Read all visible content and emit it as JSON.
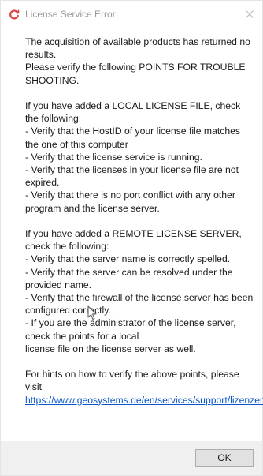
{
  "dialog": {
    "title": "License Service Error",
    "icon": "refresh-arrow-icon",
    "accent_color": "#d9473f",
    "close_icon": "close-icon"
  },
  "message": {
    "intro_1": "The acquisition of available products has returned no results.",
    "intro_2": "Please verify the following POINTS FOR TROUBLE SHOOTING.",
    "local_heading": "If you have added a LOCAL LICENSE FILE, check the following:",
    "local_items": [
      "- Verify that the HostID of your license file matches the one of this computer",
      "- Verify that the license service is running.",
      "- Verify that the licenses in your license file are not expired.",
      "- Verify that there is no port conflict with any other program and the license server."
    ],
    "remote_heading": "If you have added a REMOTE LICENSE SERVER, check the following:",
    "remote_items": [
      "- Verify that the server name is correctly spelled.",
      "- Verify that the server can be resolved under the provided name.",
      "- Verify that the firewall of the license server has been configured correctly.",
      "- If you are the administrator of the license server, check the points for a local",
      "license file on the license server as well."
    ],
    "hint_text": "For hints on how to verify the above points, please visit",
    "hint_link": "https://www.geosystems.de/en/services/support/lizenzen",
    "hint_end": "."
  },
  "buttons": {
    "ok_label": "OK"
  }
}
